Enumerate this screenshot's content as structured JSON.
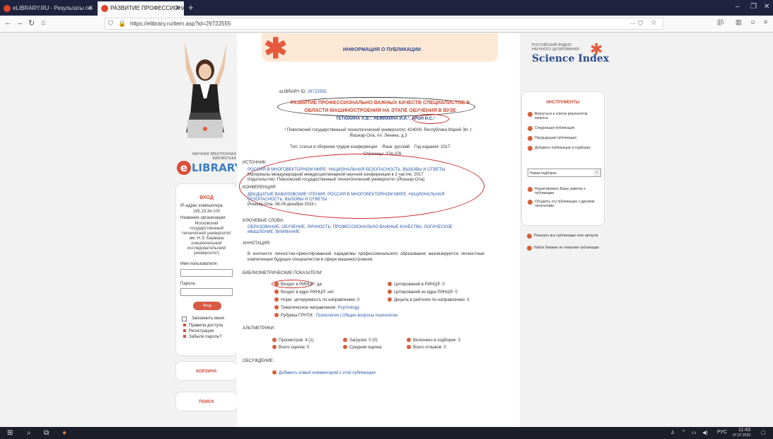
{
  "browser": {
    "tabs": [
      {
        "title": "eLIBRARY.RU - Результаты по"
      },
      {
        "title": "РАЗВИТИЕ ПРОФЕССИОНАЛЬ"
      }
    ],
    "url": "https://elibrary.ru/item.asp?id=29722555"
  },
  "header": {
    "title": "ИНФОРМАЦИЯ О ПУБЛИКАЦИИ"
  },
  "logo": {
    "small": "НАУЧНАЯ ЭЛЕКТРОННАЯ БИБЛИОТЕКА",
    "big": "LIBRARY.RU",
    "e": "e"
  },
  "login": {
    "title": "ВХОД",
    "ip_label": "IP-адрес компьютера:",
    "ip_value": "195.19.34.100",
    "org_label": "Название организации:",
    "org_value": "Московский государственный технический университет им. Н.Э. Баумана (национальный исследовательский университет)",
    "user_label": "Имя пользователя:",
    "pass_label": "Пароль:",
    "button": "Вход",
    "remember": "Запомнить меня",
    "links": [
      "Правила доступа",
      "Регистрация",
      "Забыли пароль?"
    ]
  },
  "side_buttons": [
    "КОРЗИНА",
    "ПОИСК"
  ],
  "publication": {
    "id_label": "eLIBRARY ID:",
    "id_value": "29722555",
    "title": "РАЗВИТИЕ ПРОФЕССИОНАЛЬНО ВАЖНЫХ КАЧЕСТВ СПЕЦИАЛИСТОВ В ОБЛАСТИ МАШИНОСТРОЕНИЯ НА ЭТАПЕ ОБУЧЕНИЯ В ВУЗЕ",
    "authors": "ТЕТЮХИНА А.В.¹, НЕМИХИНА И.И.¹, АРОН И.С.¹",
    "affiliation": "¹ Поволжский государственный технологический университет, 424000, Республика Марий Эл, г. Йошкар-Ола, пл. Ленина, д.3",
    "type": "Тип: статья в сборнике трудов конференции",
    "lang": "Язык: русский",
    "year": "Год издания: 2017",
    "pages": "Страницы: 374-376"
  },
  "source": {
    "label": "ИСТОЧНИК:",
    "link": "РОССИЯ В МНОГОВЕКТОРНОМ МИРЕ: НАЦИОНАЛЬНАЯ БЕЗОПАСНОСТЬ, ВЫЗОВЫ И ОТВЕТЫ",
    "line2": "Материалы международной междисциплинарной научной конференции в 2 частях. 2017",
    "line3": "Издательство: Поволжский государственный технологический университет (Йошкар-Ола)"
  },
  "conference": {
    "label": "КОНФЕРЕНЦИЯ:",
    "link": "ДВАДЦАТЫЕ ВАВИЛОВСКИЕ ЧТЕНИЯ. РОССИЯ В МНОГОВЕКТОРНОМ МИРЕ: НАЦИОНАЛЬНАЯ БЕЗОПАСНОСТЬ, ВЫЗОВЫ И ОТВЕТЫ",
    "place": "Йошкар-Ола, 08-09 декабря 2016 г."
  },
  "keywords": {
    "label": "КЛЮЧЕВЫЕ СЛОВА:",
    "value": "ОБРАЗОВАНИЕ, ОБУЧЕНИЕ, ЛИЧНОСТЬ, ПРОФЕССИОНАЛЬНО ВАЖНЫЕ КАЧЕСТВА, ЛОГИЧЕСКОЕ МЫШЛЕНИЕ, ВНИМАНИЕ"
  },
  "annotation": {
    "label": "АННОТАЦИЯ:",
    "text": "В контексте личностно-ориентированной парадигмы профессионального образования анализируются личностные компетенции будущих специалистов в сфере машиностроения."
  },
  "biblio": {
    "label": "БИБЛИОМЕТРИЧЕСКИЕ ПОКАЗАТЕЛИ:",
    "rinc": "Входит в РИНЦ®: да",
    "core": "Входит в ядро РИНЦ®: нет",
    "norm": "Норм. цитируемость по направлению: 0",
    "theme_label": "Тематическое направление:",
    "theme_value": "Psychology",
    "rubric_label": "Рубрика ГРНТИ:",
    "rubric_value": "Психология | Общие вопросы психологии",
    "cit_rinc": "Цитирований в РИНЦ®: 0",
    "cit_core": "Цитирований из ядра РИНЦ®: 0",
    "percent": "Дециль в рейтинге по направлению: 3"
  },
  "altmetrics": {
    "label": "АЛЬТМЕТРИКИ:",
    "views": "Просмотров: 4 (1)",
    "downloads": "Загрузок: 0 (0)",
    "selections": "Включено в подборки: 3",
    "ratings": "Всего оценок: 0",
    "avg": "Средняя оценка:",
    "reviews": "Всего отзывов: 0"
  },
  "discussion": {
    "label": "ОБСУЖДЕНИЕ:",
    "add": "Добавить новый комментарий к этой публикации"
  },
  "science_index": {
    "small": "РОССИЙСКИЙ ИНДЕКС НАУЧНОГО ЦИТИРОВАНИЯ",
    "big": "Science Index"
  },
  "tools": {
    "title": "ИНСТРУМЕНТЫ",
    "items": [
      "Вернуться в список результатов запроса",
      "Следующая публикация",
      "Предыдущая публикация",
      "Добавить публикацию в подборку:",
      "Редактировать Вашу заметку к публикации",
      "Обсудить эту публикацию с другими читателями",
      "Показать все публикации этих авторов",
      "Найти близкие по тематике публикации"
    ],
    "select_value": "Новая подборка"
  },
  "taskbar": {
    "lang": "РУС",
    "time": "11:43",
    "date": "07.07.2020"
  }
}
